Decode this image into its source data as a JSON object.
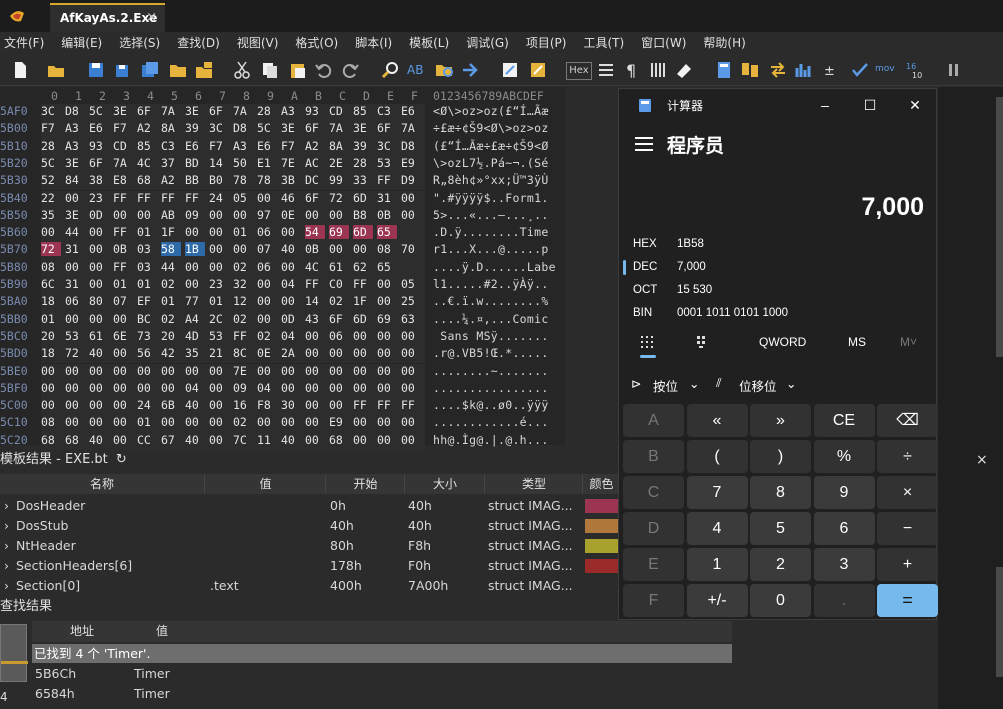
{
  "tab": {
    "title": "AfKayAs.2.Exe",
    "close": "×"
  },
  "menu": [
    "文件(F)",
    "编辑(E)",
    "选择(S)",
    "查找(D)",
    "视图(V)",
    "格式(O)",
    "脚本(I)",
    "模板(L)",
    "调试(G)",
    "项目(P)",
    "工具(T)",
    "窗口(W)",
    "帮助(H)"
  ],
  "toolbar": {
    "hex_label": "Hex",
    "mov_label": "mov"
  },
  "hex": {
    "column_header": [
      "0",
      "1",
      "2",
      "3",
      "4",
      "5",
      "6",
      "7",
      "8",
      "9",
      "A",
      "B",
      "C",
      "D",
      "E",
      "F"
    ],
    "ascii_header": "0123456789ABCDEF",
    "rows": [
      {
        "addr": "5AF0",
        "bytes": [
          "3C",
          "D8",
          "5C",
          "3E",
          "6F",
          "7A",
          "3E",
          "6F",
          "7A",
          "28",
          "A3",
          "93",
          "CD",
          "85",
          "C3",
          "E6"
        ],
        "ascii": "<Ø\\>oz>oz(£“Í…Ãæ"
      },
      {
        "addr": "5B00",
        "bytes": [
          "F7",
          "A3",
          "E6",
          "F7",
          "A2",
          "8A",
          "39",
          "3C",
          "D8",
          "5C",
          "3E",
          "6F",
          "7A",
          "3E",
          "6F",
          "7A"
        ],
        "ascii": "÷£æ÷¢Š9<Ø\\>oz>oz"
      },
      {
        "addr": "5B10",
        "bytes": [
          "28",
          "A3",
          "93",
          "CD",
          "85",
          "C3",
          "E6",
          "F7",
          "A3",
          "E6",
          "F7",
          "A2",
          "8A",
          "39",
          "3C",
          "D8"
        ],
        "ascii": "(£“Í…Ãæ÷£æ÷¢Š9<Ø"
      },
      {
        "addr": "5B20",
        "bytes": [
          "5C",
          "3E",
          "6F",
          "7A",
          "4C",
          "37",
          "BD",
          "14",
          "50",
          "E1",
          "7E",
          "AC",
          "2E",
          "28",
          "53",
          "E9"
        ],
        "ascii": "\\>ozL7½.Pá~¬.(Sé"
      },
      {
        "addr": "5B30",
        "bytes": [
          "52",
          "84",
          "38",
          "E8",
          "68",
          "A2",
          "BB",
          "B0",
          "78",
          "78",
          "3B",
          "DC",
          "99",
          "33",
          "FF",
          "D9"
        ],
        "ascii": "R„8èh¢»°xx;Ü™3ÿÙ"
      },
      {
        "addr": "5B40",
        "bytes": [
          "22",
          "00",
          "23",
          "FF",
          "FF",
          "FF",
          "FF",
          "24",
          "05",
          "00",
          "46",
          "6F",
          "72",
          "6D",
          "31",
          "00"
        ],
        "ascii": "\".#ÿÿÿÿ$..Form1."
      },
      {
        "addr": "5B50",
        "bytes": [
          "35",
          "3E",
          "0D",
          "00",
          "00",
          "AB",
          "09",
          "00",
          "00",
          "97",
          "0E",
          "00",
          "00",
          "B8",
          "0B",
          "00"
        ],
        "ascii": "5>...«...—...¸.."
      },
      {
        "addr": "5B60",
        "bytes": [
          "00",
          "44",
          "00",
          "FF",
          "01",
          "1F",
          "00",
          "00",
          "01",
          "06",
          "00",
          "54",
          "69",
          "6D",
          "65"
        ],
        "hl": [
          11,
          12,
          13,
          14
        ],
        "ascii": ".D.ÿ........Time"
      },
      {
        "addr": "5B70",
        "bytes": [
          "72",
          "31",
          "00",
          "0B",
          "03",
          "58",
          "1B",
          "00",
          "00",
          "07",
          "40",
          "0B",
          "00",
          "00",
          "08",
          "70"
        ],
        "hl": [
          0
        ],
        "sel": [
          5,
          6
        ],
        "ascii": "r1...X...@.....p"
      },
      {
        "addr": "5B80",
        "bytes": [
          "08",
          "00",
          "00",
          "FF",
          "03",
          "44",
          "00",
          "00",
          "02",
          "06",
          "00",
          "4C",
          "61",
          "62",
          "65"
        ],
        "ascii": "....ÿ.D......Labe"
      },
      {
        "addr": "5B90",
        "bytes": [
          "6C",
          "31",
          "00",
          "01",
          "01",
          "02",
          "00",
          "23",
          "32",
          "00",
          "04",
          "FF",
          "C0",
          "FF",
          "00",
          "05"
        ],
        "ascii": "l1.....#2..ÿÀÿ.."
      },
      {
        "addr": "5BA0",
        "bytes": [
          "18",
          "06",
          "80",
          "07",
          "EF",
          "01",
          "77",
          "01",
          "12",
          "00",
          "00",
          "14",
          "02",
          "1F",
          "00",
          "25"
        ],
        "ascii": "..€.ï.w........%"
      },
      {
        "addr": "5BB0",
        "bytes": [
          "01",
          "00",
          "00",
          "00",
          "BC",
          "02",
          "A4",
          "2C",
          "02",
          "00",
          "0D",
          "43",
          "6F",
          "6D",
          "69",
          "63"
        ],
        "ascii": "....¼.¤,...Comic"
      },
      {
        "addr": "5BC0",
        "bytes": [
          "20",
          "53",
          "61",
          "6E",
          "73",
          "20",
          "4D",
          "53",
          "FF",
          "02",
          "04",
          "00",
          "06",
          "00",
          "00",
          "00"
        ],
        "ascii": " Sans MSÿ......."
      },
      {
        "addr": "5BD0",
        "bytes": [
          "18",
          "72",
          "40",
          "00",
          "56",
          "42",
          "35",
          "21",
          "8C",
          "0E",
          "2A",
          "00",
          "00",
          "00",
          "00",
          "00"
        ],
        "ascii": ".r@.VB5!Œ.*....."
      },
      {
        "addr": "5BE0",
        "bytes": [
          "00",
          "00",
          "00",
          "00",
          "00",
          "00",
          "00",
          "00",
          "7E",
          "00",
          "00",
          "00",
          "00",
          "00",
          "00",
          "00"
        ],
        "ascii": "........~......."
      },
      {
        "addr": "5BF0",
        "bytes": [
          "00",
          "00",
          "00",
          "00",
          "00",
          "00",
          "04",
          "00",
          "09",
          "04",
          "00",
          "00",
          "00",
          "00",
          "00",
          "00"
        ],
        "ascii": "................"
      },
      {
        "addr": "5C00",
        "bytes": [
          "00",
          "00",
          "00",
          "00",
          "24",
          "6B",
          "40",
          "00",
          "16",
          "F8",
          "30",
          "00",
          "00",
          "FF",
          "FF",
          "FF"
        ],
        "ascii": "....$k@..ø0..ÿÿÿ"
      },
      {
        "addr": "5C10",
        "bytes": [
          "08",
          "00",
          "00",
          "00",
          "01",
          "00",
          "00",
          "00",
          "02",
          "00",
          "00",
          "00",
          "E9",
          "00",
          "00",
          "00"
        ],
        "ascii": "............é..."
      },
      {
        "addr": "5C20",
        "bytes": [
          "68",
          "68",
          "40",
          "00",
          "CC",
          "67",
          "40",
          "00",
          "7C",
          "11",
          "40",
          "00",
          "68",
          "00",
          "00",
          "00"
        ],
        "ascii": "hh@.Ìg@.|.@.h..."
      }
    ]
  },
  "template": {
    "title": "模板结果 - EXE.bt",
    "columns": [
      "名称",
      "值",
      "开始",
      "大小",
      "类型",
      "颜色"
    ],
    "rows": [
      {
        "name": "DosHeader",
        "value": "",
        "start": "0h",
        "size": "40h",
        "type": "struct IMAG...",
        "color": "#9b3552"
      },
      {
        "name": "DosStub",
        "value": "",
        "start": "40h",
        "size": "40h",
        "type": "struct IMAG...",
        "color": "#b0783a"
      },
      {
        "name": "NtHeader",
        "value": "",
        "start": "80h",
        "size": "F8h",
        "type": "struct IMAG...",
        "color": "#a9a12e"
      },
      {
        "name": "SectionHeaders[6]",
        "value": "",
        "start": "178h",
        "size": "F0h",
        "type": "struct IMAG...",
        "color": "#9b2a2a"
      },
      {
        "name": "Section[0]",
        "value": ".text",
        "start": "400h",
        "size": "7A00h",
        "type": "struct IMAG...",
        "color": "#2b2b2b"
      }
    ]
  },
  "find": {
    "title": "查找结果",
    "columns": [
      "地址",
      "值"
    ],
    "summary": "已找到 4 个 'Timer'.",
    "rows": [
      {
        "addr": "5B6Ch",
        "value": "Timer"
      },
      {
        "addr": "6584h",
        "value": "Timer"
      }
    ],
    "side_number": "4"
  },
  "calculator": {
    "title": "计算器",
    "mode": "程序员",
    "display": "7,000",
    "radix": [
      {
        "label": "HEX",
        "value": "1B58"
      },
      {
        "label": "DEC",
        "value": "7,000",
        "active": true
      },
      {
        "label": "OCT",
        "value": "15 530"
      },
      {
        "label": "BIN",
        "value": "0001 1011 0101 1000"
      }
    ],
    "word_size": "QWORD",
    "ms": "MS",
    "mplus": "M˅",
    "bitwise": "按位",
    "bitshift": "位移位",
    "keys": [
      [
        "A",
        "«",
        "»",
        "CE",
        "⌫"
      ],
      [
        "B",
        "(",
        ")",
        "%",
        "÷"
      ],
      [
        "C",
        "7",
        "8",
        "9",
        "×"
      ],
      [
        "D",
        "4",
        "5",
        "6",
        "−"
      ],
      [
        "E",
        "1",
        "2",
        "3",
        "+"
      ],
      [
        "F",
        "+/-",
        "0",
        ".",
        "="
      ]
    ]
  }
}
